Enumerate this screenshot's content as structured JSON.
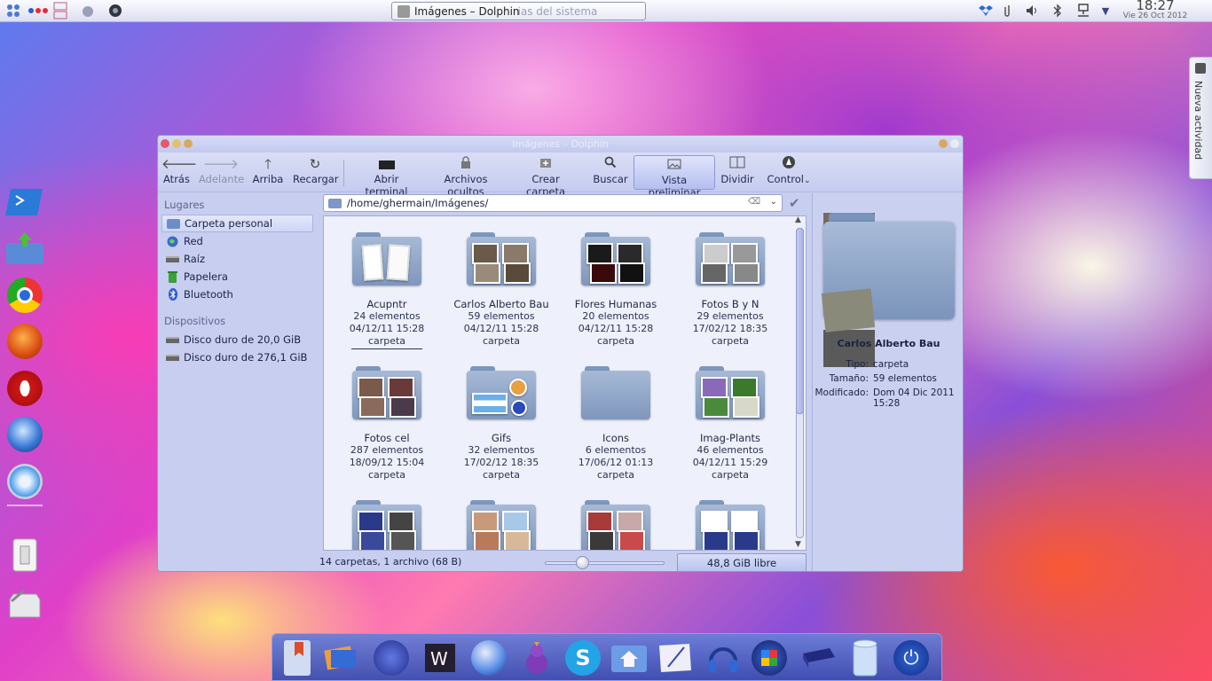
{
  "panel": {
    "task_title": "Imágenes – Dolphin",
    "task_ghost": "ias del sistema",
    "clock_time": "18:27",
    "clock_date": "Vie 26 Oct 2012"
  },
  "activity": {
    "label": "Nueva actividad"
  },
  "window": {
    "title": "Imágenes – Dolphin",
    "toolbar": {
      "back": "Atrás",
      "forward": "Adelante",
      "up": "Arriba",
      "reload": "Recargar",
      "terminal": "Abrir terminal",
      "hidden": "Archivos ocultos",
      "new_folder": "Crear carpeta",
      "search": "Buscar",
      "preview": "Vista preliminar",
      "split": "Dividir",
      "control": "Control"
    },
    "places": {
      "heading_places": "Lugares",
      "items": [
        {
          "label": "Carpeta personal"
        },
        {
          "label": "Red"
        },
        {
          "label": "Raíz"
        },
        {
          "label": "Papelera"
        },
        {
          "label": "Bluetooth"
        }
      ],
      "heading_devices": "Dispositivos",
      "devices": [
        {
          "label": "Disco duro de 20,0 GiB"
        },
        {
          "label": "Disco duro de 276,1 GiB"
        }
      ]
    },
    "path": "/home/ghermain/Imágenes/",
    "items": [
      {
        "name": "Acupntr",
        "count": "24 elementos",
        "date": "04/12/11 15:28",
        "type": "carpeta"
      },
      {
        "name": "Carlos Alberto Bau",
        "count": "59 elementos",
        "date": "04/12/11 15:28",
        "type": "carpeta"
      },
      {
        "name": "Flores Humanas",
        "count": "20 elementos",
        "date": "04/12/11 15:28",
        "type": "carpeta"
      },
      {
        "name": "Fotos B y N",
        "count": "29 elementos",
        "date": "17/02/12 18:35",
        "type": "carpeta"
      },
      {
        "name": "Fotos cel",
        "count": "287 elementos",
        "date": "18/09/12 15:04",
        "type": "carpeta"
      },
      {
        "name": "Gifs",
        "count": "32 elementos",
        "date": "17/02/12 18:35",
        "type": "carpeta"
      },
      {
        "name": "Icons",
        "count": "6 elementos",
        "date": "17/06/12 01:13",
        "type": "carpeta"
      },
      {
        "name": "Imag-Plants",
        "count": "46 elementos",
        "date": "04/12/11 15:29",
        "type": "carpeta"
      }
    ],
    "status": "14 carpetas, 1 archivo (68 B)",
    "free_space": "48,8 GiB libre",
    "info": {
      "name": "Carlos Alberto Bau",
      "type_label": "Tipo:",
      "type_value": "carpeta",
      "size_label": "Tamaño:",
      "size_value": "59 elementos",
      "modified_label": "Modificado:",
      "modified_value": "Dom 04 Dic 2011 15:28"
    }
  },
  "colors": {
    "accent": "#b5bff0",
    "folder": "#8fa5c8"
  }
}
